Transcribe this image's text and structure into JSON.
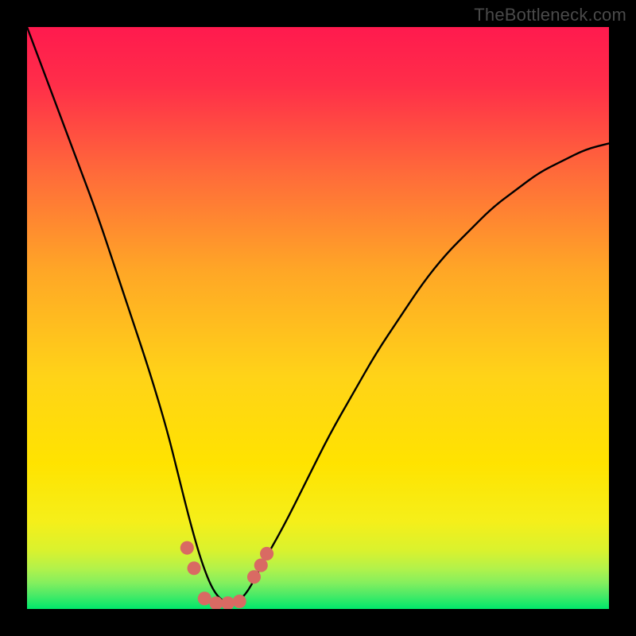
{
  "watermark": "TheBottleneck.com",
  "chart_data": {
    "type": "line",
    "title": "",
    "xlabel": "",
    "ylabel": "",
    "xlim": [
      0,
      100
    ],
    "ylim": [
      0,
      100
    ],
    "grid": false,
    "legend": false,
    "background_gradient_top": "#ff1a4e",
    "background_gradient_mid": "#ffe300",
    "background_gradient_bottom": "#00e86b",
    "series": [
      {
        "name": "curve",
        "color": "#000000",
        "x": [
          0,
          3,
          6,
          9,
          12,
          15,
          18,
          21,
          24,
          26,
          28,
          30,
          32,
          34,
          36,
          38,
          40,
          44,
          48,
          52,
          56,
          60,
          64,
          68,
          72,
          76,
          80,
          84,
          88,
          92,
          96,
          100
        ],
        "y": [
          100,
          92,
          84,
          76,
          68,
          59,
          50,
          41,
          31,
          23,
          15,
          8,
          3,
          1,
          1,
          3,
          7,
          14,
          22,
          30,
          37,
          44,
          50,
          56,
          61,
          65,
          69,
          72,
          75,
          77,
          79,
          80
        ]
      }
    ],
    "markers": {
      "name": "trough-beads",
      "color": "#d96a63",
      "radius_px": 9,
      "points": [
        {
          "x": 27.5,
          "y": 10.5
        },
        {
          "x": 28.7,
          "y": 7.0
        },
        {
          "x": 30.5,
          "y": 1.8
        },
        {
          "x": 32.5,
          "y": 1.0
        },
        {
          "x": 34.5,
          "y": 1.0
        },
        {
          "x": 36.5,
          "y": 1.3
        },
        {
          "x": 39.0,
          "y": 5.5
        },
        {
          "x": 40.2,
          "y": 7.5
        },
        {
          "x": 41.2,
          "y": 9.5
        }
      ]
    }
  }
}
